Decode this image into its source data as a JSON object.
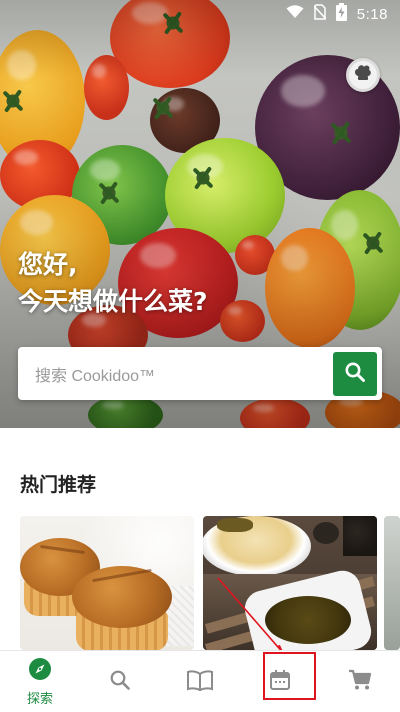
{
  "status_bar": {
    "time": "5:18",
    "icons": [
      "wifi-icon",
      "no-sim-icon",
      "battery-charging-icon"
    ]
  },
  "hero": {
    "greeting_line1": "您好,",
    "greeting_line2": "今天想做什么菜?",
    "chef_icon": "chef-hat-icon"
  },
  "search": {
    "placeholder": "搜索 Cookidoo™",
    "button_icon": "search-icon"
  },
  "popular": {
    "title": "热门推荐",
    "cards": [
      {
        "image": "muffins-photo"
      },
      {
        "image": "noodles-and-minced-meat-photo"
      },
      {
        "image": "partial-recipe-photo"
      }
    ]
  },
  "bottom_nav": {
    "items": [
      {
        "label": "探索",
        "icon": "compass-icon",
        "active": true
      },
      {
        "label": "",
        "icon": "search-icon",
        "active": false
      },
      {
        "label": "",
        "icon": "book-icon",
        "active": false
      },
      {
        "label": "",
        "icon": "calendar-icon",
        "active": false
      },
      {
        "label": "",
        "icon": "cart-icon",
        "active": false
      }
    ]
  },
  "colors": {
    "brand_green": "#1d8b40",
    "inactive_icon": "#8c8c8c",
    "annotation_red": "#e0141e"
  }
}
